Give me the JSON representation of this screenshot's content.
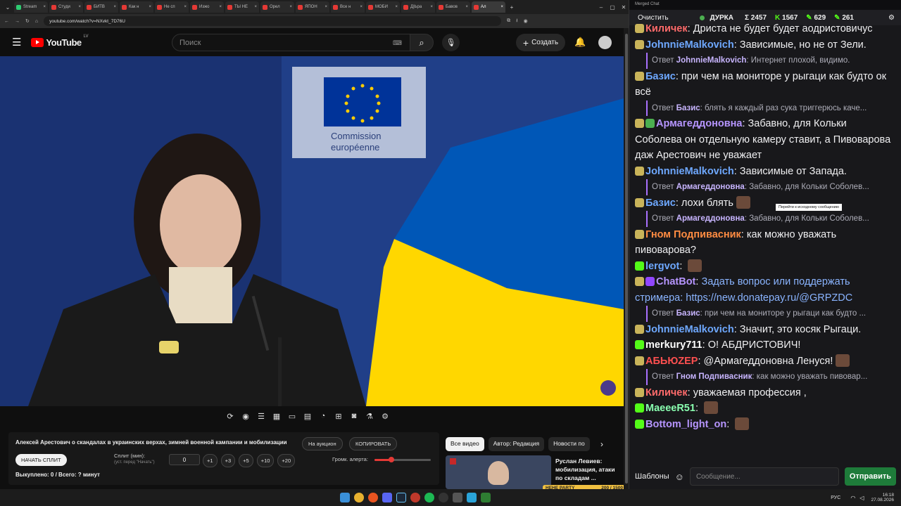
{
  "browser": {
    "tabs": [
      "Stream",
      "Студи",
      "БИТВ",
      "Как н",
      "Не сп",
      "Изжо",
      "ТЫ НЕ",
      "Орел",
      "ЯПОН",
      "Все н",
      "МОБИ",
      "Д|Ьра",
      "Бавов",
      "Ал"
    ],
    "active_tab": 13,
    "url": "youtube.com/watch?v=NXvkt_7D76U"
  },
  "youtube": {
    "logo_text": "YouTube",
    "region": "LV",
    "search_placeholder": "Поиск",
    "create_label": "Создать"
  },
  "video": {
    "eu_sign_line1": "Commission",
    "eu_sign_line2": "européenne"
  },
  "panel": {
    "title": "Алексей Арестович о скандалах в украинских верхах, зимней военной кампании и мобилизации",
    "auction_label": "На аукцион",
    "copy_label": "КОПИРОВАТЬ",
    "split_button": "НАЧАТЬ СПЛИТ",
    "split_label": "Сплит (мин):",
    "split_hint": "(уст. перед \"Начать\")",
    "split_value": "0",
    "increments": [
      "+1",
      "+3",
      "+5",
      "+10",
      "+20"
    ],
    "volume_label": "Громк. алерта:",
    "volume_level": 0.3,
    "status": "Выкуплено: 0 / Всего: ? минут"
  },
  "chips": [
    "Все видео",
    "Автор: Редакция",
    "Новости по"
  ],
  "recommended": {
    "title": "Руслан Левиев: мобилизация, атаки по складам ...",
    "overlay_badge": "HEHE PARTY",
    "overlay_count": "200 / 1500"
  },
  "chat": {
    "window_title": "Merged Chat",
    "clear_label": "Очистить",
    "channel": "ДУРКА",
    "stats": [
      "Σ 2457",
      "1567",
      "629",
      "261"
    ],
    "tooltip": "Перейти к исходному сообщению",
    "input_placeholder": "Сообщение...",
    "templates_label": "Шаблоны",
    "send_label": "Отправить",
    "messages": [
      {
        "kind": "msg",
        "user": "Киличек",
        "color": "#ff6b6b",
        "text": "Дриста не будет будет аодристовичус"
      },
      {
        "kind": "msg",
        "user": "JohnnieMalkovich",
        "color": "#6ea8ff",
        "text": "Зависимые, но не от Зели."
      },
      {
        "kind": "reply",
        "user": "JohnnieMalkovich",
        "text": "Интернет плохой, видимо."
      },
      {
        "kind": "msg",
        "user": "Базис",
        "color": "#6ea8ff",
        "text": "при чем на мониторе у рыгаци как будто ок всё"
      },
      {
        "kind": "reply",
        "user": "Базис",
        "text": "блять я каждый раз сука триггерюсь каче..."
      },
      {
        "kind": "msg",
        "user": "Армагеддоновна",
        "color": "#b695ff",
        "text": "Забавно, для Кольки Соболева он отдельную камеру ставит, а Пивоварова даж Арестович не уважает"
      },
      {
        "kind": "msg",
        "user": "JohnnieMalkovich",
        "color": "#6ea8ff",
        "text": "Зависимые от Запада."
      },
      {
        "kind": "reply",
        "user": "Армагеддоновна",
        "text": "Забавно, для Кольки Соболев..."
      },
      {
        "kind": "msg",
        "user": "Базис",
        "color": "#6ea8ff",
        "text": "лохи блять"
      },
      {
        "kind": "reply",
        "user": "Армагеддоновна",
        "text": "Забавно, для Кольки Соболев..."
      },
      {
        "kind": "msg",
        "user": "Гном Подпивасник",
        "color": "#ff8c42",
        "text": "как можно уважать пивоварова?"
      },
      {
        "kind": "msg",
        "user": "lergvot",
        "color": "#6ea8ff",
        "text": ""
      },
      {
        "kind": "msg",
        "user": "ChatBot",
        "color": "#b695ff",
        "text": "Задать вопрос или поддержать стримера: https://new.donatepay.ru/@GRPZDC"
      },
      {
        "kind": "reply",
        "user": "Базис",
        "text": "при чем на мониторе у рыгаци как будто ..."
      },
      {
        "kind": "msg",
        "user": "JohnnieMalkovich",
        "color": "#6ea8ff",
        "text": "Значит, это косяк Рыгаци."
      },
      {
        "kind": "msg",
        "user": "merkury711",
        "color": "#ffffff",
        "text": "О! АБДРИСТОВИЧ!"
      },
      {
        "kind": "msg",
        "user": "АБЬЮZEP",
        "color": "#ff5050",
        "text": "@Армагеддоновна Ленуся!"
      },
      {
        "kind": "reply",
        "user": "Гном Подпивасник",
        "text": "как можно уважать пивовар..."
      },
      {
        "kind": "msg",
        "user": "Киличек",
        "color": "#ff6b6b",
        "text": "уважаемая профессия ,"
      },
      {
        "kind": "msg",
        "user": "MaeeeR51",
        "color": "#8affb0",
        "text": ""
      },
      {
        "kind": "msg",
        "user": "Bottom_light_on",
        "color": "#b695ff",
        "text": ""
      }
    ]
  },
  "taskbar": {
    "lang": "РУС",
    "time": "16:18",
    "date": "27.08.2026"
  },
  "colors": {
    "youtube_red": "#ff0000",
    "chat_accent": "#a970ff",
    "send_green": "#1e7b3a",
    "ukraine_blue": "#0057b7",
    "ukraine_yellow": "#ffd700"
  }
}
